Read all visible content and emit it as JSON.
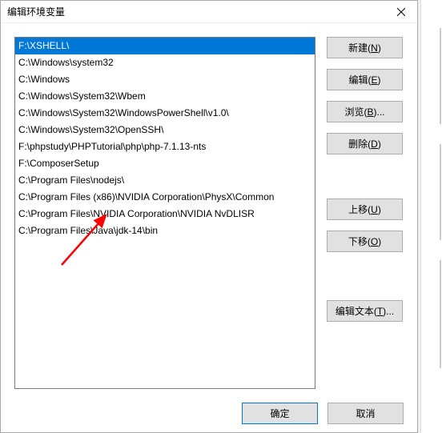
{
  "dialog": {
    "title": "编辑环境变量"
  },
  "list": {
    "items": [
      "F:\\XSHELL\\",
      "C:\\Windows\\system32",
      "C:\\Windows",
      "C:\\Windows\\System32\\Wbem",
      "C:\\Windows\\System32\\WindowsPowerShell\\v1.0\\",
      "C:\\Windows\\System32\\OpenSSH\\",
      "F:\\phpstudy\\PHPTutorial\\php\\php-7.1.13-nts",
      "F:\\ComposerSetup",
      "C:\\Program Files\\nodejs\\",
      "C:\\Program Files (x86)\\NVIDIA Corporation\\PhysX\\Common",
      "C:\\Program Files\\NVIDIA Corporation\\NVIDIA NvDLISR",
      "C:\\Program Files\\Java\\jdk-14\\bin"
    ],
    "selected_index": 0
  },
  "buttons": {
    "new": {
      "label": "新建",
      "key": "N"
    },
    "edit": {
      "label": "编辑",
      "key": "E"
    },
    "browse": {
      "label": "浏览",
      "key": "B",
      "suffix": "..."
    },
    "delete": {
      "label": "删除",
      "key": "D"
    },
    "moveup": {
      "label": "上移",
      "key": "U"
    },
    "movedown": {
      "label": "下移",
      "key": "O"
    },
    "edittext": {
      "label": "编辑文本",
      "key": "T",
      "suffix": "..."
    },
    "ok": "确定",
    "cancel": "取消"
  }
}
